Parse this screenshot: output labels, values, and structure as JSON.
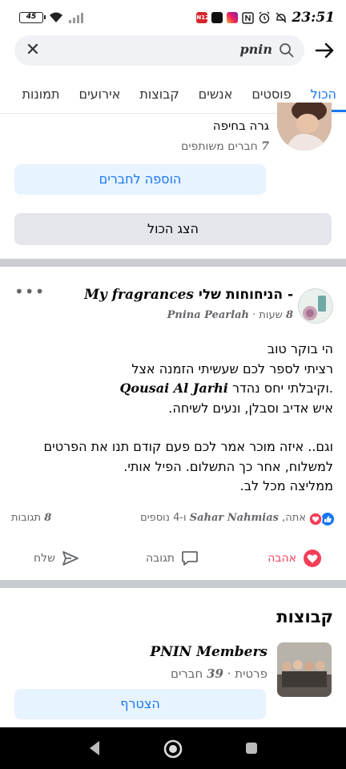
{
  "status_bar": {
    "battery": "45",
    "time": "23:51",
    "app_badge": "N12"
  },
  "search": {
    "query": "pnin"
  },
  "tabs": [
    {
      "label": "הכול",
      "active": true
    },
    {
      "label": "פוסטים",
      "active": false
    },
    {
      "label": "אנשים",
      "active": false
    },
    {
      "label": "קבוצות",
      "active": false
    },
    {
      "label": "אירועים",
      "active": false
    },
    {
      "label": "תמונות",
      "active": false
    }
  ],
  "person": {
    "location": "גרה בחיפה",
    "mutual_count": "7",
    "mutual_label": "חברים משותפים",
    "add_friend_label": "הוספה לחברים",
    "show_all_label": "הצג הכול"
  },
  "post": {
    "title_latin": "My fragrances",
    "title_hebrew": "- הניחוחות שלי",
    "author": "Pnina Pearlah",
    "time_number": "8",
    "time_unit": "שעות",
    "more": "•••",
    "lines": {
      "l1": "הי בוקר טוב",
      "l2": "רציתי לספר לכם שעשיתי הזמנה אצל",
      "l3_pre": ".וקיבלתי יחס נהדר",
      "l3_name": "Qousai Al Jarhi",
      "l4": "איש אדיב וסבלן, ונעים לשיחה.",
      "l5": "וגם.. איזה מוכר אמר לכם פעם קודם תנו את הפרטים",
      "l6": "למשלוח, אחר כך התשלום. הפיל אותי.",
      "l7": "ממליצה מכל לב."
    },
    "reactions": {
      "you": "אתה,",
      "name": "Sahar Nahmias",
      "and": "ו-",
      "others_count": "4",
      "others_label": "נוספים",
      "comments_count": "8",
      "comments_label": "תגובות"
    },
    "actions": {
      "love": "אהבה",
      "comment": "תגובה",
      "share": "שלח"
    }
  },
  "groups": {
    "section_title": "קבוצות",
    "name": "PNIN Members",
    "privacy": "פרטית",
    "member_count": "39",
    "member_label": "חברים",
    "join_label": "הצטרף"
  },
  "colors": {
    "accent": "#1877f2",
    "love": "#f33e58",
    "divider": "#c9ccd1"
  }
}
